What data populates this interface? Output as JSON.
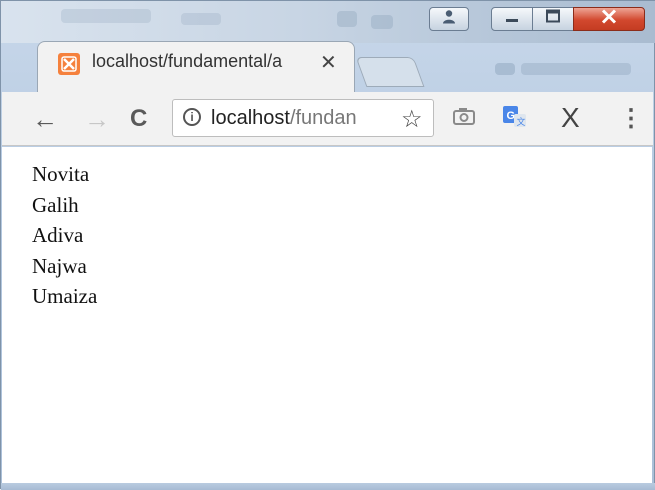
{
  "window": {
    "controls": {
      "user_icon": "person-icon",
      "minimize_icon": "minimize-icon",
      "maximize_icon": "maximize-icon",
      "close_icon": "close-icon"
    }
  },
  "tab": {
    "favicon": "xampp-icon",
    "title": "localhost/fundamental/a",
    "close_label": "✕"
  },
  "toolbar": {
    "back_label": "←",
    "forward_label": "→",
    "reload_label": "C",
    "info_label": "i",
    "url_host": "localhost",
    "url_path": "/fundan",
    "bookmark_label": "☆",
    "camera_icon": "camera-icon",
    "translate_icon": "translate-icon",
    "extension_label": "X",
    "menu_label": "⋮"
  },
  "page": {
    "names": [
      "Novita",
      "Galih",
      "Adiva",
      "Najwa",
      "Umaiza"
    ]
  },
  "colors": {
    "tab_favicon": "#f5813d",
    "close_button": "#d2482e",
    "translate_blue": "#4a86e8"
  }
}
